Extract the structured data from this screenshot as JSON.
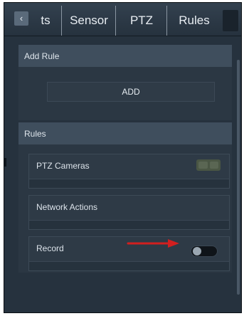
{
  "tabs": [
    {
      "label": "ts"
    },
    {
      "label": "Sensor"
    },
    {
      "label": "PTZ"
    },
    {
      "label": "Rules"
    }
  ],
  "back_glyph": "‹",
  "add_rule": {
    "header": "Add Rule",
    "button_label": "ADD"
  },
  "rules": {
    "header": "Rules",
    "items": [
      {
        "label": "PTZ Cameras",
        "control": "ptz-toggle"
      },
      {
        "label": "Network Actions",
        "control": "none"
      },
      {
        "label": "Record",
        "control": "switch",
        "enabled": false
      }
    ]
  },
  "annotation": {
    "color": "#d21f1f"
  }
}
